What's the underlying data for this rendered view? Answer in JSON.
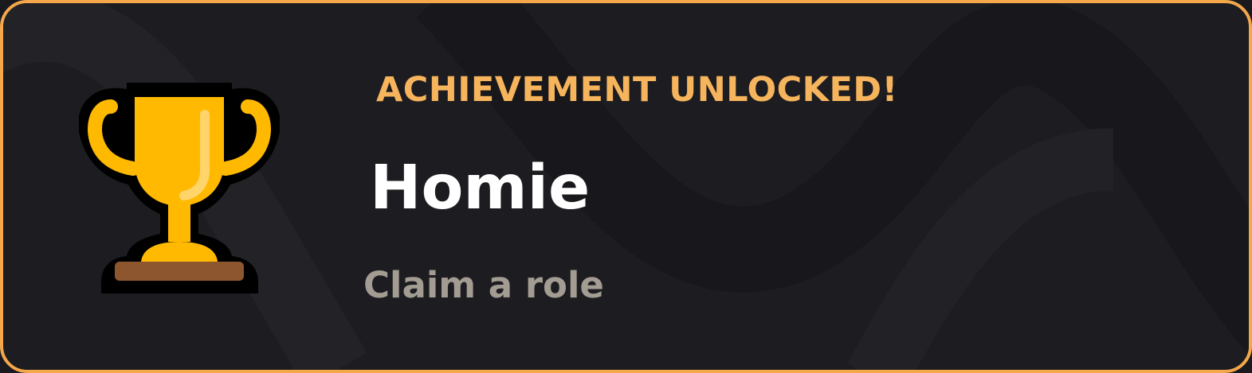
{
  "achievement": {
    "heading": "ACHIEVEMENT UNLOCKED!",
    "title": "Homie",
    "description": "Claim a role",
    "icon": "trophy-icon"
  },
  "colors": {
    "border": "#f4a84a",
    "heading": "#f6b45c",
    "title": "#ffffff",
    "description": "#a39c93",
    "background": "#1d1d21",
    "trophy_gold": "#ffb900",
    "trophy_base": "#8e562e"
  }
}
